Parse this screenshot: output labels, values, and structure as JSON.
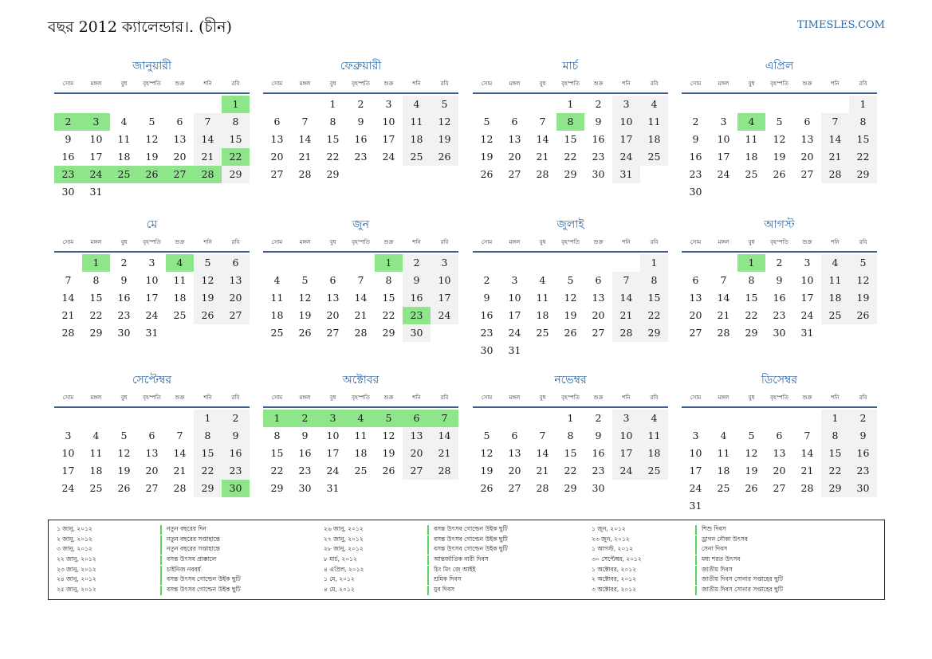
{
  "header": {
    "title": "বছর 2012 ক্যালেন্ডার।. (চীন)",
    "site": "TIMESLES.COM"
  },
  "weekdays": [
    "সোম",
    "মঙ্গল",
    "বুধ",
    "বৃহস্পতি",
    "শুক্র",
    "শনি",
    "রবি"
  ],
  "months": [
    {
      "name": "জানুয়ারী",
      "start": 6,
      "days": 31,
      "holidays": [
        1,
        2,
        3,
        22,
        23,
        24,
        25,
        26,
        27,
        28
      ]
    },
    {
      "name": "ফেব্রুয়ারী",
      "start": 2,
      "days": 29,
      "holidays": []
    },
    {
      "name": "মার্চ",
      "start": 3,
      "days": 31,
      "holidays": [
        8
      ]
    },
    {
      "name": "এপ্রিল",
      "start": 6,
      "days": 30,
      "holidays": [
        4
      ]
    },
    {
      "name": "মে",
      "start": 1,
      "days": 31,
      "holidays": [
        1,
        4
      ]
    },
    {
      "name": "জুন",
      "start": 4,
      "days": 30,
      "holidays": [
        1,
        23
      ]
    },
    {
      "name": "জুলাই",
      "start": 6,
      "days": 31,
      "holidays": []
    },
    {
      "name": "আগস্ট",
      "start": 2,
      "days": 31,
      "holidays": [
        1
      ]
    },
    {
      "name": "সেপ্টেম্বর",
      "start": 5,
      "days": 30,
      "holidays": [
        30
      ]
    },
    {
      "name": "অক্টোবর",
      "start": 0,
      "days": 31,
      "holidays": [
        1,
        2,
        3,
        4,
        5,
        6,
        7
      ]
    },
    {
      "name": "নভেম্বর",
      "start": 3,
      "days": 30,
      "holidays": []
    },
    {
      "name": "ডিসেম্বর",
      "start": 5,
      "days": 31,
      "holidays": []
    }
  ],
  "legend": [
    [
      {
        "date": "১ জানু, ২০১২",
        "name": "নতুন বছরের দিন"
      },
      {
        "date": "২ জানু, ২০১২",
        "name": "নতুন বছরের সপ্তাহান্তে"
      },
      {
        "date": "৩ জানু, ২০১২",
        "name": "নতুন বছরের সপ্তাহান্তে"
      },
      {
        "date": "২২ জানু, ২০১২",
        "name": "বসন্ত উৎসব প্রাক্কালে"
      },
      {
        "date": "২৩ জানু, ২০১২",
        "name": "চাইনিজ নববর্ষ"
      },
      {
        "date": "২৪ জানু, ২০১২",
        "name": "বসন্ত উৎসব গোল্ডেন উইক ছুটি"
      },
      {
        "date": "২৫ জানু, ২০১২",
        "name": "বসন্ত উৎসব গোল্ডেন উইক ছুটি"
      }
    ],
    [
      {
        "date": "২৬ জানু, ২০১২",
        "name": "বসন্ত উৎসব গোল্ডেন উইক ছুটি"
      },
      {
        "date": "২৭ জানু, ২০১২",
        "name": "বসন্ত উৎসব গোল্ডেন উইক ছুটি"
      },
      {
        "date": "২৮ জানু, ২০১২",
        "name": "বসন্ত উৎসব গোল্ডেন উইক ছুটি"
      },
      {
        "date": "৮ মার্চ, ২০১২",
        "name": "আন্তর্জাতিক নারী দিবস"
      },
      {
        "date": "৪ এপ্রিল, ২০১২",
        "name": "চিং মিং জে আইই"
      },
      {
        "date": "১ মে, ২০১২",
        "name": "শ্রমিক দিবস"
      },
      {
        "date": "৪ মে, ২০১২",
        "name": "যুব দিবস"
      }
    ],
    [
      {
        "date": "১ জুন, ২০১২",
        "name": "শিশু দিবস"
      },
      {
        "date": "২৩ জুন, ২০১২",
        "name": "ড্রাগন নৌকা উৎসব"
      },
      {
        "date": "১ আগস্ট, ২০১২",
        "name": "সেনা দিবস"
      },
      {
        "date": "৩০ সেপ্টেম্বর, ২০১২",
        "name": "মধ্য শরত উৎসব"
      },
      {
        "date": "১ অক্টোবর, ২০১২",
        "name": "জাতীয় দিবস"
      },
      {
        "date": "২ অক্টোবর, ২০১২",
        "name": "জাতীয় দিবস সোনার সপ্তাহের ছুটি"
      },
      {
        "date": "৩ অক্টোবর, ২০১২",
        "name": "জাতীয় দিবস সোনার সপ্তাহের ছুটি"
      }
    ]
  ]
}
